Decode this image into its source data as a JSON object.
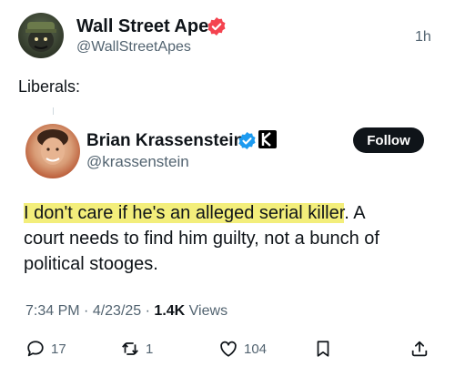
{
  "post": {
    "author_name": "Wall Street Apes",
    "author_handle": "@WallStreetApes",
    "time": "1h",
    "text": "Liberals:"
  },
  "quoted": {
    "author_name": "Brian Krassenstein",
    "author_handle": "@krassenstein",
    "follow_label": "Follow",
    "text_highlighted": "I don't care if he's an alleged serial killer",
    "text_line1_rest": ". A",
    "text_line2": "court needs to find him guilty, not a bunch of",
    "text_line3": "political stooges.",
    "time": "7:34 PM",
    "date": "4/23/25",
    "views_count": "1.4K",
    "views_label": "Views",
    "replies": "17",
    "reposts": "1",
    "likes": "104",
    "colors": {
      "highlight": "#f3ee7b",
      "verified": "#1d9bf0"
    }
  },
  "icons": [
    "verified-badge-icon",
    "affiliate-k-badge-icon",
    "reply-icon",
    "repost-icon",
    "like-icon",
    "bookmark-icon",
    "share-icon"
  ]
}
